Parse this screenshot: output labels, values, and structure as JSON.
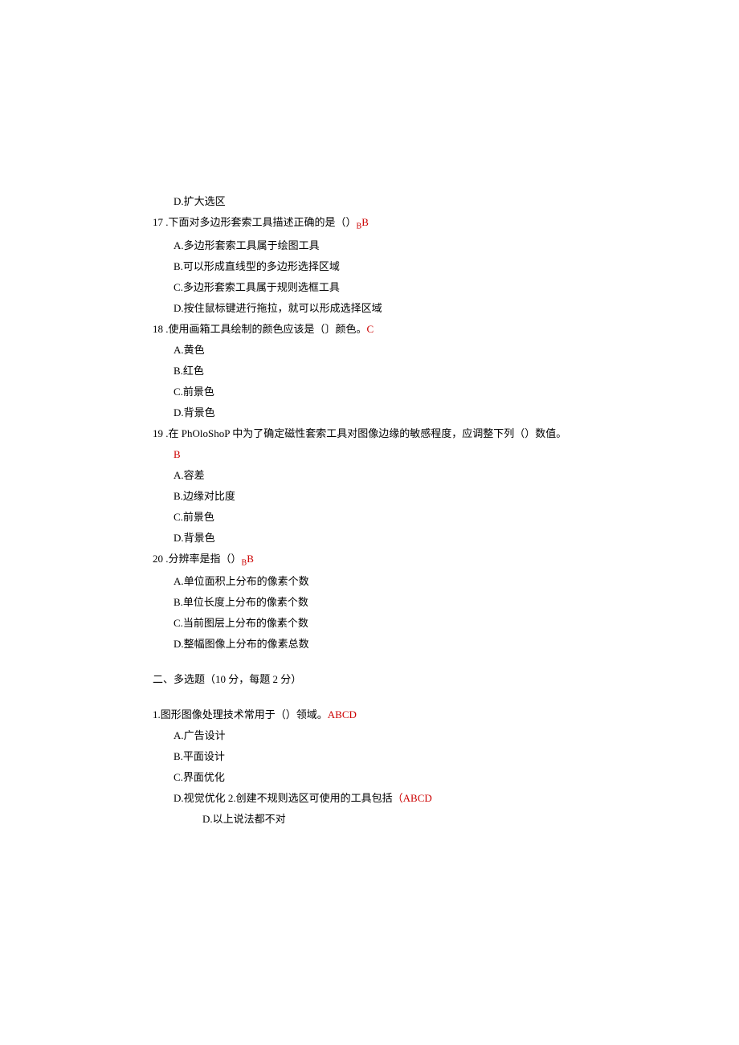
{
  "q16": {
    "optD": "D.扩大选区"
  },
  "q17": {
    "num": "17",
    "text": " .下面对多边形套索工具描述正确的是（）",
    "subB": "B",
    "ans": "B",
    "optA": "A.多边形套索工具属于绘图工具",
    "optB": "B.可以形成直线型的多边形选择区域",
    "optC": "C.多边形套索工具属于规则选框工具",
    "optD": "D.按住鼠标键进行拖拉，就可以形成选择区域"
  },
  "q18": {
    "num": "18",
    "text": " .使用画箱工具绘制的颜色应该是（〕颜色。",
    "ans": "C",
    "optA": "A.黄色",
    "optB": "B.红色",
    "optC": "C.前景色",
    "optD": "D.背景色"
  },
  "q19": {
    "num": "19",
    "text": " .在 PhOloShoP 中为了确定磁性套索工具对图像边缘的敏感程度，应调整下列（）数值。",
    "ans": "B",
    "optA": "A.容差",
    "optB": "B.边缘对比度",
    "optC": "C.前景色",
    "optD": "D.背景色"
  },
  "q20": {
    "num": "20",
    "text": " .分辨率是指（）",
    "subB": "B",
    "ans": "B",
    "optA": "A.单位面积上分布的像素个数",
    "optB": "B.单位长度上分布的像素个数",
    "optC": "C.当前图层上分布的像素个数",
    "optD": "D.整幅图像上分布的像素总数"
  },
  "section2": {
    "heading": "二、多选题（10 分，每题 2 分）"
  },
  "mq1": {
    "num": "1.",
    "text": "图形图像处理技术常用于（）领域。",
    "ans": "ABCD",
    "optA": "A.广告设计",
    "optB": "B.平面设计",
    "optC": "C.界面优化",
    "optD_prefix": "D.视觉优化 2.创建不规则选区可使用的工具包括",
    "optD_paren": "（",
    "optD_ans": "ABCD",
    "subD": "D.以上说法都不对"
  }
}
